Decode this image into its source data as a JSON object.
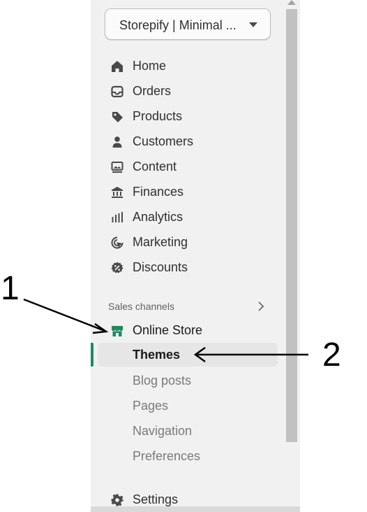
{
  "store_selector": {
    "label": "Storepify | Minimal ..."
  },
  "nav": {
    "items": [
      {
        "label": "Home",
        "icon": "home-icon"
      },
      {
        "label": "Orders",
        "icon": "inbox-icon"
      },
      {
        "label": "Products",
        "icon": "tag-icon"
      },
      {
        "label": "Customers",
        "icon": "person-icon"
      },
      {
        "label": "Content",
        "icon": "image-icon"
      },
      {
        "label": "Finances",
        "icon": "bank-icon"
      },
      {
        "label": "Analytics",
        "icon": "bar-chart-icon"
      },
      {
        "label": "Marketing",
        "icon": "target-icon"
      },
      {
        "label": "Discounts",
        "icon": "discount-icon"
      }
    ]
  },
  "sales_channels": {
    "label": "Sales channels",
    "online_store": {
      "label": "Online Store",
      "icon": "store-icon",
      "icon_color": "#1e8a5e"
    },
    "sub_items": [
      {
        "label": "Themes",
        "selected": true
      },
      {
        "label": "Blog posts"
      },
      {
        "label": "Pages"
      },
      {
        "label": "Navigation"
      },
      {
        "label": "Preferences"
      }
    ]
  },
  "settings": {
    "label": "Settings",
    "icon": "gear-icon"
  },
  "annotations": {
    "label_1": "1",
    "label_2": "2"
  },
  "colors": {
    "accent": "#1e8a5e",
    "text": "#303030",
    "muted": "#7a7a7a",
    "sidebar_bg": "#f1f1f1"
  }
}
